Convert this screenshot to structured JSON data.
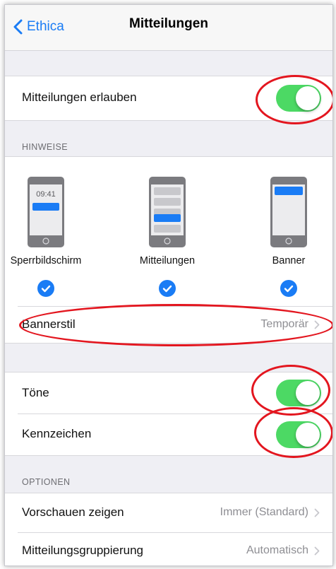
{
  "navbar": {
    "back_label": "Ethica",
    "title": "Mitteilungen"
  },
  "allow_notifications": {
    "label": "Mitteilungen erlauben",
    "enabled": true
  },
  "alerts": {
    "header": "HINWEISE",
    "styles": [
      {
        "label": "Sperrbildschirm",
        "time": "09:41",
        "checked": true
      },
      {
        "label": "Mitteilungen",
        "checked": true
      },
      {
        "label": "Banner",
        "checked": true
      }
    ],
    "banner_style": {
      "label": "Bannerstil",
      "value": "Temporär"
    }
  },
  "sounds": {
    "label": "Töne",
    "enabled": true
  },
  "badges": {
    "label": "Kennzeichen",
    "enabled": true
  },
  "options": {
    "header": "OPTIONEN",
    "previews": {
      "label": "Vorschauen zeigen",
      "value": "Immer (Standard)"
    },
    "grouping": {
      "label": "Mitteilungsgruppierung",
      "value": "Automatisch"
    }
  },
  "colors": {
    "accent": "#1a7cf5",
    "toggle_on": "#4cd964",
    "annotation": "#e3161f"
  }
}
